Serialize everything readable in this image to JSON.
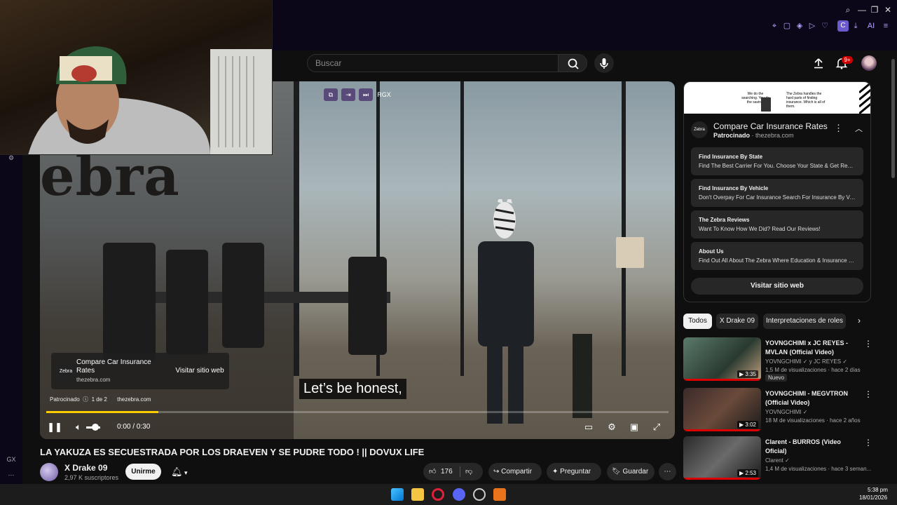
{
  "browser": {
    "minimize_icon": "—",
    "maximize_icon": "❐",
    "close_icon": "✕",
    "ext_avatar_label": "C",
    "ai_label": "AI",
    "sidebar_gx_label": "GX"
  },
  "header": {
    "search_placeholder": "Buscar",
    "notification_count": "9+"
  },
  "video": {
    "brand_text": "ebra",
    "overlay_top_label": "RGX",
    "subtitle": "Let’s be honest,",
    "ad_card": {
      "logo_text": "Zebra",
      "title": "Compare Car Insurance Rates",
      "domain": "thezebra.com",
      "button": "Visitar sitio web"
    },
    "ad_meta": {
      "sponsored": "Patrocinado",
      "position": "1 de 2",
      "domain": "thezebra.com"
    },
    "progress_fraction": 0.18,
    "time": "0:00 / 0:30",
    "title": "LA YAKUZA ES SECUESTRADA POR LOS DRAEVEN Y SE PUDRE TODO ! || DOVUX LIFE"
  },
  "channel": {
    "name": "X Drake 09",
    "subscribers": "2,97 K suscriptores",
    "subscribe_label": "Unirme"
  },
  "actions": {
    "like_count": "176",
    "share": "Compartir",
    "ask": "Preguntar",
    "save": "Guardar"
  },
  "ad_panel": {
    "banner_left": "We do the searching. You do the saving.",
    "banner_right": "The Zebra handles the hard parts of finding insurance. Which is all of them.",
    "logo_text": "Zebra",
    "title": "Compare Car Insurance Rates",
    "sponsored": "Patrocinado",
    "domain": "thezebra.com",
    "links": [
      {
        "title": "Find Insurance By State",
        "desc": "Find The Best Carrier For You. Choose Your State & Get Real ..."
      },
      {
        "title": "Find Insurance By Vehicle",
        "desc": "Don't Overpay For Car Insurance Search For Insurance By Veh..."
      },
      {
        "title": "The Zebra Reviews",
        "desc": "Want To Know How We Did? Read Our Reviews!"
      },
      {
        "title": "About Us",
        "desc": "Find Out All About The Zebra Where Education & Insurance M..."
      }
    ],
    "visit": "Visitar sitio web"
  },
  "chips": [
    "Todos",
    "X Drake 09",
    "Interpretaciones de roles"
  ],
  "recommendations": [
    {
      "title": "YOVNGCHIMI x JC REYES - MVLAN (Official Video)",
      "channel": "YOVNGCHIMI",
      "channel_extra": "y JC REYES",
      "meta": "1,5 M de visualizaciones · hace 2 días",
      "badge": "Nuevo",
      "duration": "3:35"
    },
    {
      "title": "YOVNGCHIMI - MEGVTRON (Official Video)",
      "channel": "YOVNGCHIMI",
      "meta": "18 M de visualizaciones · hace 2 años",
      "duration": "3:02"
    },
    {
      "title": "Clarent - BURROS (Video Oficial)",
      "channel": "Clarent",
      "meta": "1,4 M de visualizaciones · hace 3 seman...",
      "duration": "2:53"
    }
  ],
  "taskbar": {
    "time": "5:38 pm",
    "date": "18/01/2026"
  }
}
